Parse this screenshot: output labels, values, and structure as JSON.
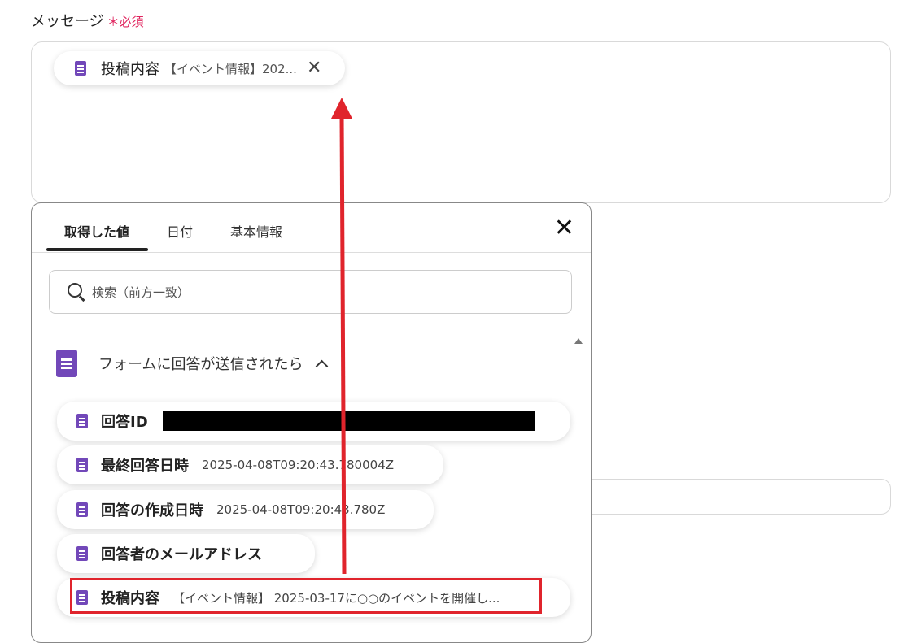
{
  "field": {
    "label": "メッセージ",
    "required_mark": "＊必須"
  },
  "message_chip": {
    "name": "投稿内容",
    "value": "【イベント情報】202...",
    "remove_icon": "close-icon"
  },
  "popup": {
    "tabs": [
      {
        "label": "取得した値",
        "active": true
      },
      {
        "label": "日付",
        "active": false
      },
      {
        "label": "基本情報",
        "active": false
      }
    ],
    "search_placeholder": "検索（前方一致）",
    "group_title": "フォームに回答が送信されたら",
    "items": [
      {
        "name": "回答ID",
        "value": ""
      },
      {
        "name": "最終回答日時",
        "value": "2025-04-08T09:20:43.780004Z"
      },
      {
        "name": "回答の作成日時",
        "value": "2025-04-08T09:20:43.780Z"
      },
      {
        "name": "回答者のメールアドレス",
        "value": ""
      },
      {
        "name": "投稿内容",
        "value": "【イベント情報】 2025-03-17に○○のイベントを開催し..."
      }
    ]
  },
  "colors": {
    "accent_purple": "#7248b9",
    "highlight_red": "#e0242c",
    "required_pink": "#e0245e"
  }
}
